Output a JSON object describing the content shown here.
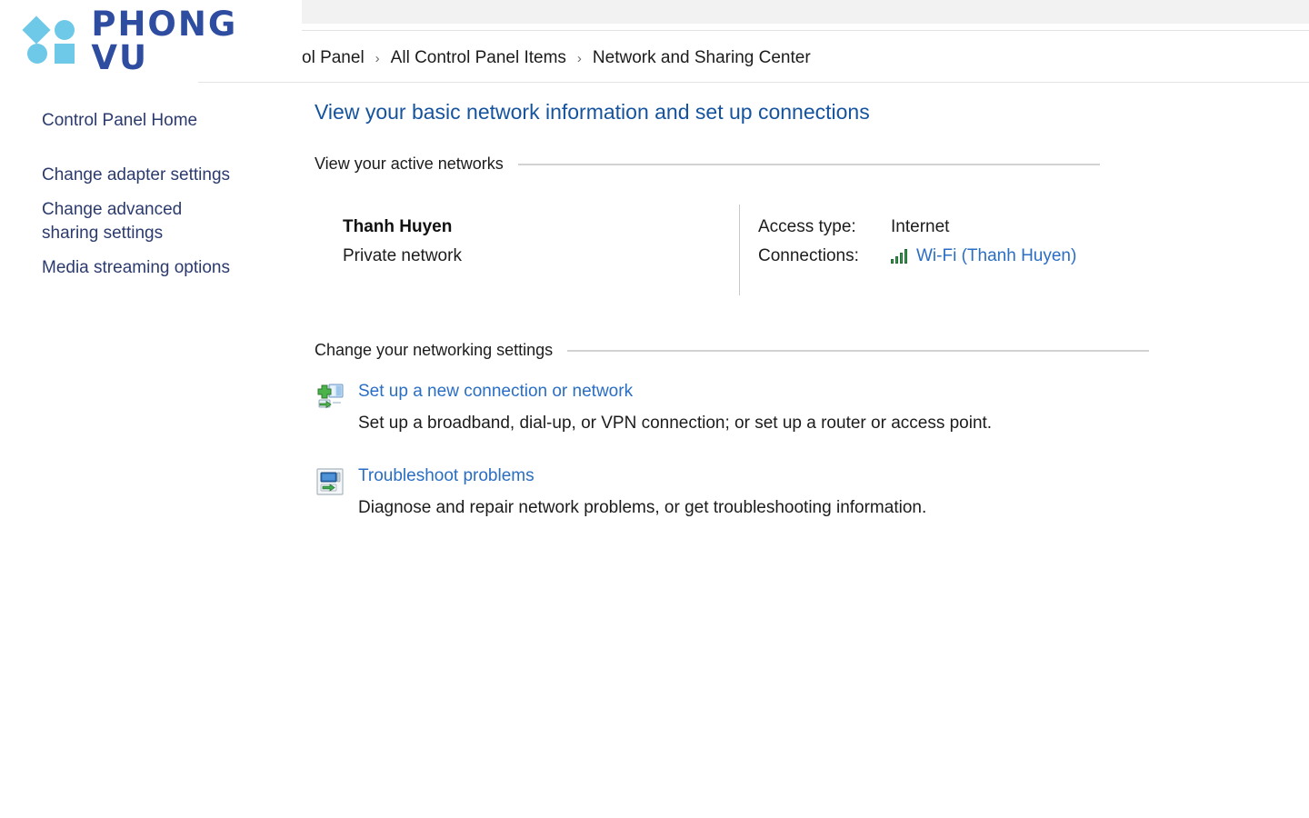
{
  "window": {
    "breadcrumb": {
      "items": [
        "ol Panel",
        "All Control Panel Items",
        "Network and Sharing Center"
      ],
      "separator": "›"
    }
  },
  "branding": {
    "name": "PHONG VU",
    "mark_color": "#6ec9e8",
    "word_color": "#2f4da0"
  },
  "sidebar": {
    "items": [
      {
        "label": "Control Panel Home"
      },
      {
        "label": "Change adapter settings"
      },
      {
        "label": "Change advanced sharing settings"
      },
      {
        "label": "Media streaming options"
      }
    ]
  },
  "main": {
    "heading": "View your basic network information and set up connections",
    "active_networks": {
      "section_title": "View your active networks",
      "network_name": "Thanh Huyen",
      "network_type": "Private network",
      "access_type_label": "Access type:",
      "access_type_value": "Internet",
      "connections_label": "Connections:",
      "connections_value": "Wi-Fi (Thanh Huyen)",
      "signal_icon": "wifi-signal-icon"
    },
    "change_settings": {
      "section_title": "Change your networking settings",
      "tasks": [
        {
          "icon": "new-connection-icon",
          "link": "Set up a new connection or network",
          "description": "Set up a broadband, dial-up, or VPN connection; or set up a router or access point."
        },
        {
          "icon": "troubleshoot-icon",
          "link": "Troubleshoot problems",
          "description": "Diagnose and repair network problems, or get troubleshooting information."
        }
      ]
    }
  },
  "colors": {
    "heading_blue": "#15539e",
    "link_blue": "#2a6ec4",
    "sidebar_blue": "#2c3b6e",
    "toolbar_gray": "#f2f2f2"
  }
}
